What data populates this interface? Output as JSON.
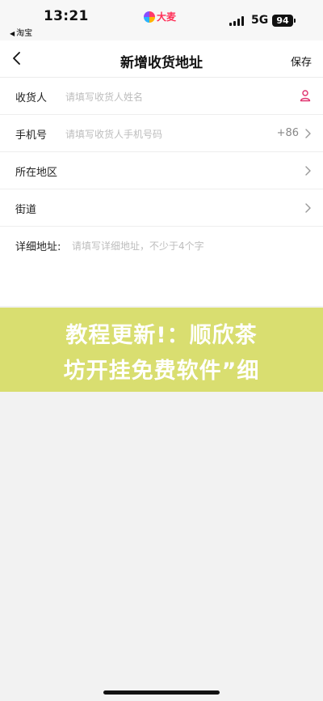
{
  "status_bar": {
    "time": "13:21",
    "back_app": "淘宝",
    "logo_text": "大麦",
    "network": "5G",
    "battery": "94"
  },
  "nav": {
    "title": "新增收货地址",
    "save_label": "保存"
  },
  "form": {
    "recipient": {
      "label": "收货人",
      "placeholder": "请填写收货人姓名",
      "icon": "person-icon"
    },
    "phone": {
      "label": "手机号",
      "placeholder": "请填写收货人手机号码",
      "prefix": "+86"
    },
    "region": {
      "label": "所在地区"
    },
    "street": {
      "label": "街道"
    },
    "detail": {
      "label": "详细地址:",
      "placeholder": "请填写详细地址，不少于4个字"
    }
  },
  "banner": {
    "line1": "教程更新!：顺欣茶",
    "line2": "坊开挂免费软件”细",
    "color": "#d9de70"
  },
  "colors": {
    "accent": "#e0326e",
    "placeholder": "#bdbdbd"
  }
}
